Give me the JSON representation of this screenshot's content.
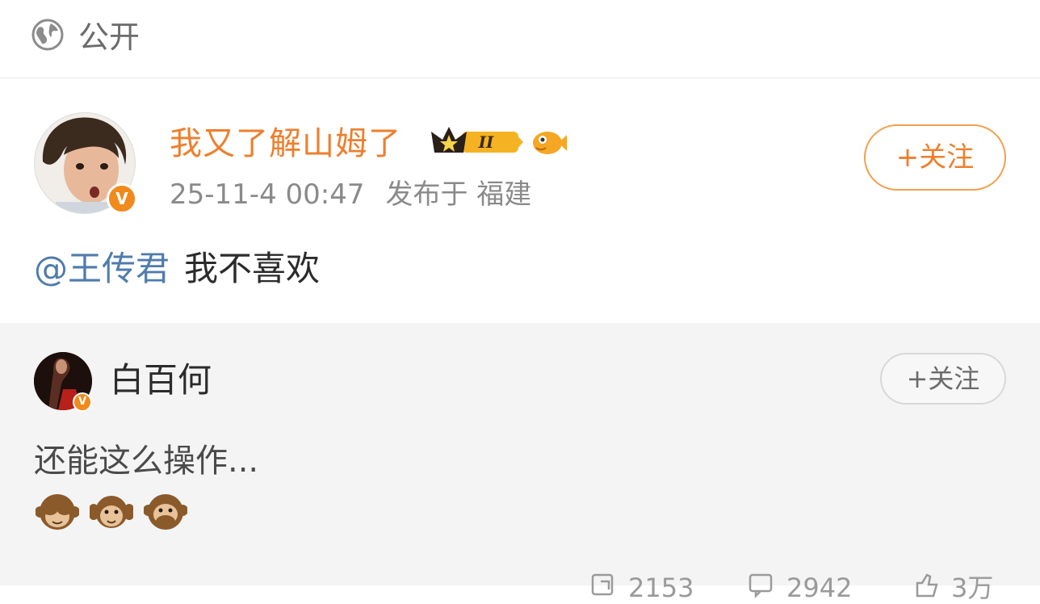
{
  "visibility": {
    "label": "公开",
    "icon": "globe-icon"
  },
  "post": {
    "author": "我又了解山姆了",
    "badges": {
      "level": "II",
      "crown_icon": "crown-icon",
      "fish_icon": "fish-icon"
    },
    "timestamp": "25-11-4 00:47",
    "location": "发布于 福建",
    "follow_label": "+关注",
    "mention": "@王传君",
    "text": "我不喜欢"
  },
  "repost": {
    "author": "白百何",
    "follow_label": "+关注",
    "text": "还能这么操作...",
    "emojis": [
      "see-no-evil-monkey",
      "hear-no-evil-monkey",
      "speak-no-evil-monkey"
    ]
  },
  "actions": {
    "share_count": "2153",
    "comment_count": "2942",
    "like_count": "3万"
  },
  "colors": {
    "username": "#ee7f2d",
    "mention": "#4f7cab",
    "verified_badge": "#f08a1c",
    "repost_bg": "#f4f4f4"
  }
}
